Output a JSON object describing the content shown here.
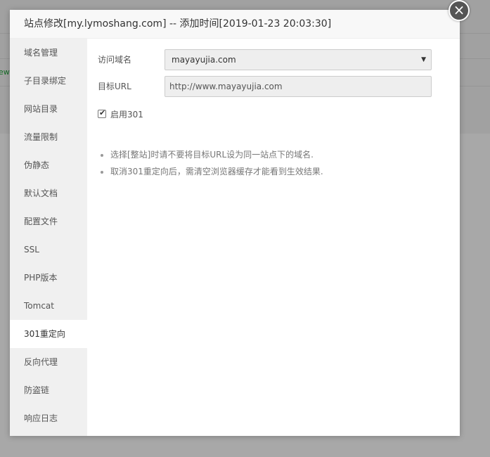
{
  "background": {
    "partial_text": "ew"
  },
  "dialog": {
    "title": "站点修改[my.lymoshang.com] -- 添加时间[2019-01-23 20:03:30]",
    "close_symbol": "×"
  },
  "sidebar": {
    "items": [
      {
        "label": "域名管理"
      },
      {
        "label": "子目录绑定"
      },
      {
        "label": "网站目录"
      },
      {
        "label": "流量限制"
      },
      {
        "label": "伪静态"
      },
      {
        "label": "默认文档"
      },
      {
        "label": "配置文件"
      },
      {
        "label": "SSL"
      },
      {
        "label": "PHP版本"
      },
      {
        "label": "Tomcat"
      },
      {
        "label": "301重定向",
        "active": true
      },
      {
        "label": "反向代理"
      },
      {
        "label": "防盗链"
      },
      {
        "label": "响应日志"
      }
    ]
  },
  "form": {
    "domain_label": "访问域名",
    "domain_value": "mayayujia.com",
    "target_label": "目标URL",
    "target_value": "http://www.mayayujia.com",
    "enable_label": "启用301",
    "enable_checked": true
  },
  "tips": [
    "选择[整站]时请不要将目标URL设为同一站点下的域名.",
    "取消301重定向后，需清空浏览器缓存才能看到生效结果."
  ],
  "colors": {
    "accent": "#20a53a",
    "sidebar_bg": "#f0f0f0",
    "overlay": "rgba(0,0,0,0.34)"
  }
}
